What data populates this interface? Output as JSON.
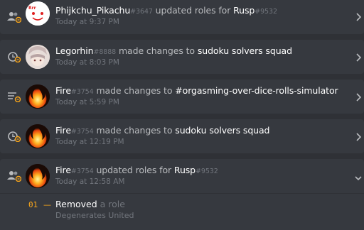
{
  "entries": [
    {
      "icon": "members-update-icon",
      "avatar": "pikachu-avatar",
      "user": "Phijkchu_Pikachu",
      "discriminator": "#3647",
      "action": "updated roles for",
      "target": "Rusp",
      "target_discriminator": "#9532",
      "time": "Today at 9:37 PM"
    },
    {
      "icon": "clock-update-icon",
      "avatar": "anime-avatar",
      "user": "Legorhin",
      "discriminator": "#8888",
      "action": "made changes to",
      "target": "sudoku solvers squad",
      "time": "Today at 8:03 PM"
    },
    {
      "icon": "channel-update-icon",
      "avatar": "fire-avatar",
      "user": "Fire",
      "discriminator": "#3754",
      "action": "made changes to",
      "target": "#orgasming-over-dice-rolls-simulator",
      "time": "Today at 5:59 PM"
    },
    {
      "icon": "clock-update-icon",
      "avatar": "fire-avatar",
      "user": "Fire",
      "discriminator": "#3754",
      "action": "made changes to",
      "target": "sudoku solvers squad",
      "time": "Today at 12:19 PM"
    },
    {
      "icon": "members-update-icon",
      "avatar": "fire-avatar",
      "user": "Fire",
      "discriminator": "#3754",
      "action": "updated roles for",
      "target": "Rusp",
      "target_discriminator": "#9532",
      "time": "Today at 12:58 AM"
    }
  ],
  "expanded_change": {
    "number": "01",
    "dash": "—",
    "verb": "Removed",
    "object": "a role",
    "role_name": "Degenerates United"
  },
  "colors": {
    "background": "#2f3136",
    "entry": "#36393f",
    "username": "#ffffff",
    "muted": "#72767d",
    "text": "#b9bbbe",
    "change_number": "#faa61a"
  }
}
